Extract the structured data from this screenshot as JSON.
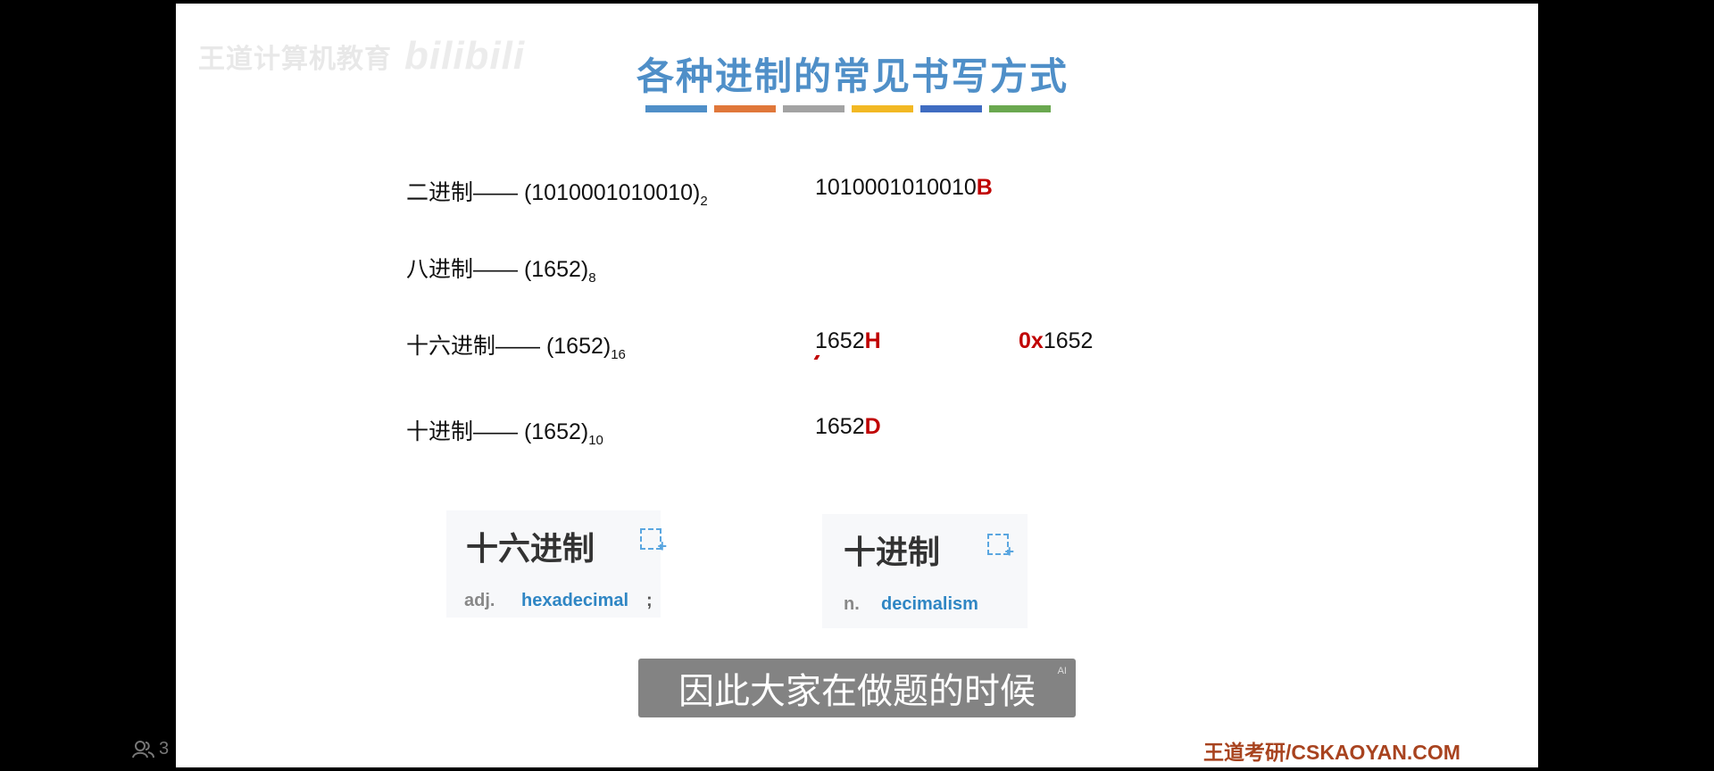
{
  "watermark": {
    "text": "王道计算机教育",
    "bili": "bilibili"
  },
  "title": "各种进制的常见书写方式",
  "bar_colors": [
    "#4f8fc8",
    "#e0773a",
    "#a3a3a3",
    "#f2b823",
    "#3f6cc1",
    "#6aa84f"
  ],
  "rows": {
    "binary": {
      "label": "二进制—— ",
      "value": "(1010001010010)",
      "sub": "2",
      "alt": "1010001010010",
      "alt_suffix": "B"
    },
    "octal": {
      "label": "八进制—— ",
      "value": "(1652)",
      "sub": "8"
    },
    "hex": {
      "label": "十六进制—— ",
      "value": "(1652)",
      "sub": "16",
      "alt": "1652",
      "alt_suffix": "H",
      "alt2_prefix": "0x",
      "alt2": "1652"
    },
    "decimal": {
      "label": "十进制—— ",
      "value": "(1652)",
      "sub": "10",
      "alt": "1652",
      "alt_suffix": "D"
    }
  },
  "cards": [
    {
      "term": "十六进制",
      "pos": "adj.",
      "def": "hexadecimal",
      "semi": ";"
    },
    {
      "term": "十进制",
      "pos": "n.",
      "def": "decimalism"
    }
  ],
  "subtitle": {
    "text": "因此大家在做题的时候",
    "ai": "AI"
  },
  "footer": "王道考研/CSKAOYAN.COM",
  "viewer": {
    "count": "3"
  }
}
